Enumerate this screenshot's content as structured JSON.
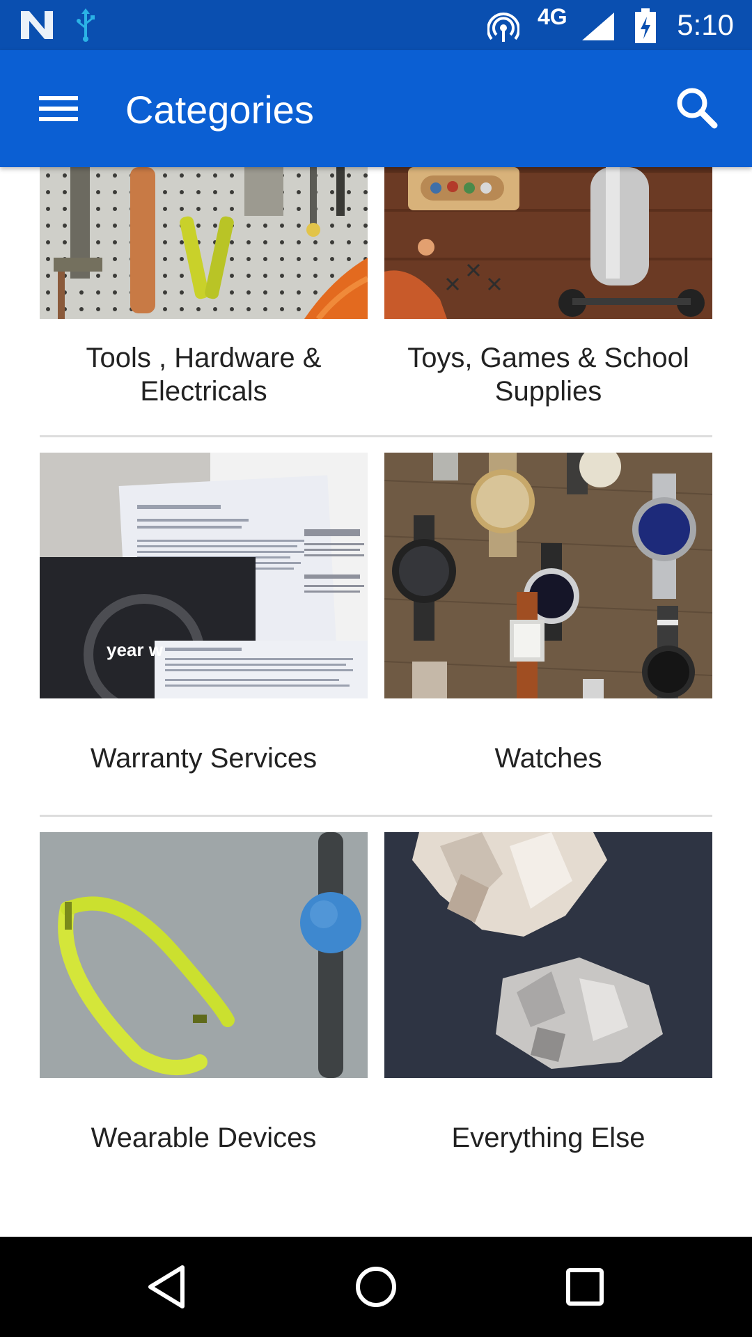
{
  "status_bar": {
    "time": "5:10",
    "network": "4G",
    "icons": [
      "n-logo-icon",
      "usb-icon",
      "hotspot-icon",
      "signal-icon",
      "battery-icon"
    ]
  },
  "app_bar": {
    "title": "Categories",
    "menu_icon": "hamburger-menu-icon",
    "search_icon": "search-icon"
  },
  "categories": [
    {
      "label_line1": "Tools , Hardware &",
      "label_line2": "Electricals"
    },
    {
      "label_line1": "Toys, Games & School",
      "label_line2": "Supplies"
    },
    {
      "label": "Warranty Services",
      "image_text": "year w"
    },
    {
      "label": "Watches"
    },
    {
      "label": "Wearable Devices"
    },
    {
      "label": "Everything Else"
    }
  ],
  "nav_bar": {
    "icons": [
      "back-icon",
      "home-icon",
      "recents-icon"
    ]
  },
  "colors": {
    "status_bar": "#0a4fb0",
    "app_bar": "#0b5fd3",
    "nav_bar": "#000000",
    "divider": "#dddddd"
  }
}
